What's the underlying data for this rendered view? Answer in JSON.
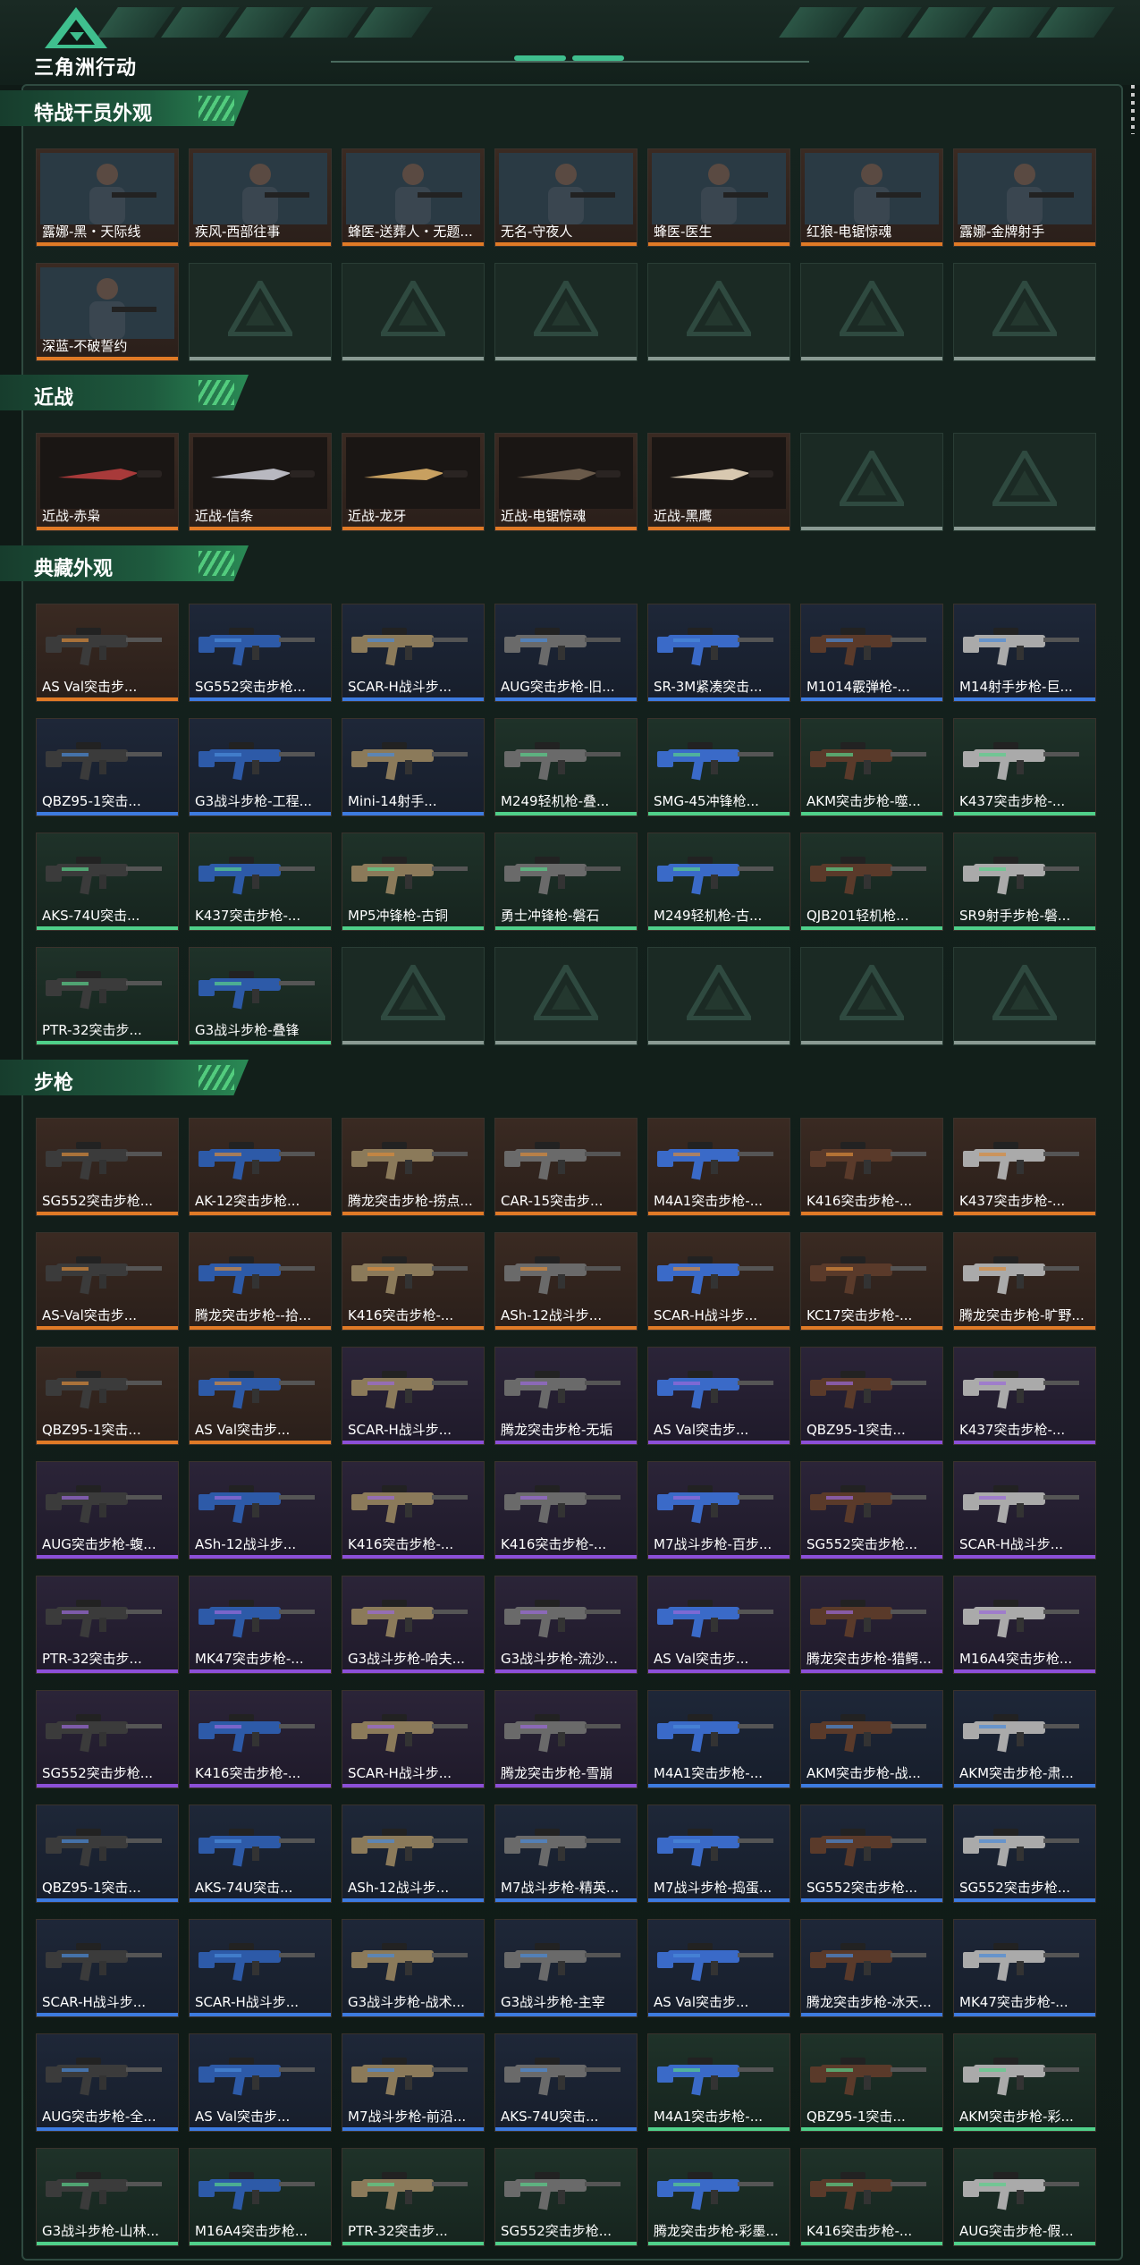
{
  "app": {
    "title": "三角洲行动",
    "logo_icon": "delta-triangle-logo-icon",
    "colors": {
      "accent": "#2a8a55",
      "orange": "#e07a26",
      "purple": "#8c4fd8",
      "blue": "#3d7be0",
      "green": "#4fd08a"
    }
  },
  "sections": [
    {
      "title": "特战干员外观",
      "items": [
        {
          "name": "露娜-黑・天际线",
          "tier": "orange"
        },
        {
          "name": "疾风-西部往事",
          "tier": "orange"
        },
        {
          "name": "蜂医-送葬人・无题...",
          "tier": "orange"
        },
        {
          "name": "无名-守夜人",
          "tier": "orange"
        },
        {
          "name": "蜂医-医生",
          "tier": "orange"
        },
        {
          "name": "红狼-电锯惊魂",
          "tier": "orange"
        },
        {
          "name": "露娜-金牌射手",
          "tier": "orange"
        },
        {
          "name": "深蓝-不破誓约",
          "tier": "orange"
        }
      ],
      "empty_slots": 6
    },
    {
      "title": "近战",
      "items": [
        {
          "name": "近战-赤枭",
          "tier": "orange"
        },
        {
          "name": "近战-信条",
          "tier": "orange"
        },
        {
          "name": "近战-龙牙",
          "tier": "orange"
        },
        {
          "name": "近战-电锯惊魂",
          "tier": "orange"
        },
        {
          "name": "近战-黑鹰",
          "tier": "orange"
        }
      ],
      "empty_slots": 2
    },
    {
      "title": "典藏外观",
      "items": [
        {
          "name": "AS Val突击步...",
          "tier": "orange"
        },
        {
          "name": "SG552突击步枪...",
          "tier": "blue"
        },
        {
          "name": "SCAR-H战斗步...",
          "tier": "blue"
        },
        {
          "name": "AUG突击步枪-旧...",
          "tier": "blue"
        },
        {
          "name": "SR-3M紧凑突击...",
          "tier": "blue"
        },
        {
          "name": "M1014霰弹枪-...",
          "tier": "blue"
        },
        {
          "name": "M14射手步枪-巨...",
          "tier": "blue"
        },
        {
          "name": "QBZ95-1突击...",
          "tier": "blue"
        },
        {
          "name": "G3战斗步枪-工程...",
          "tier": "blue"
        },
        {
          "name": "Mini-14射手...",
          "tier": "blue"
        },
        {
          "name": "M249轻机枪-叠...",
          "tier": "green"
        },
        {
          "name": "SMG-45冲锋枪...",
          "tier": "green"
        },
        {
          "name": "AKM突击步枪-噬...",
          "tier": "green"
        },
        {
          "name": "K437突击步枪-...",
          "tier": "green"
        },
        {
          "name": "AKS-74U突击...",
          "tier": "green"
        },
        {
          "name": "K437突击步枪-...",
          "tier": "green"
        },
        {
          "name": "MP5冲锋枪-古铜",
          "tier": "green"
        },
        {
          "name": "勇士冲锋枪-磐石",
          "tier": "green"
        },
        {
          "name": "M249轻机枪-古...",
          "tier": "green"
        },
        {
          "name": "QJB201轻机枪...",
          "tier": "green"
        },
        {
          "name": "SR9射手步枪-磐...",
          "tier": "green"
        },
        {
          "name": "PTR-32突击步...",
          "tier": "green"
        },
        {
          "name": "G3战斗步枪-叠锋",
          "tier": "green"
        }
      ],
      "empty_slots": 5
    },
    {
      "title": "步枪",
      "items": [
        {
          "name": "SG552突击步枪...",
          "tier": "orange"
        },
        {
          "name": "AK-12突击步枪...",
          "tier": "orange"
        },
        {
          "name": "腾龙突击步枪-捞点...",
          "tier": "orange"
        },
        {
          "name": "CAR-15突击步...",
          "tier": "orange"
        },
        {
          "name": "M4A1突击步枪-...",
          "tier": "orange"
        },
        {
          "name": "K416突击步枪-...",
          "tier": "orange"
        },
        {
          "name": "K437突击步枪-...",
          "tier": "orange"
        },
        {
          "name": "AS-Val突击步...",
          "tier": "orange"
        },
        {
          "name": "腾龙突击步枪--拾...",
          "tier": "orange"
        },
        {
          "name": "K416突击步枪-...",
          "tier": "orange"
        },
        {
          "name": "ASh-12战斗步...",
          "tier": "orange"
        },
        {
          "name": "SCAR-H战斗步...",
          "tier": "orange"
        },
        {
          "name": "KC17突击步枪-...",
          "tier": "orange"
        },
        {
          "name": "腾龙突击步枪-旷野...",
          "tier": "orange"
        },
        {
          "name": "QBZ95-1突击...",
          "tier": "orange"
        },
        {
          "name": "AS Val突击步...",
          "tier": "orange"
        },
        {
          "name": "SCAR-H战斗步...",
          "tier": "purple"
        },
        {
          "name": "腾龙突击步枪-无垢",
          "tier": "purple"
        },
        {
          "name": "AS Val突击步...",
          "tier": "purple"
        },
        {
          "name": "QBZ95-1突击...",
          "tier": "purple"
        },
        {
          "name": "K437突击步枪-...",
          "tier": "purple"
        },
        {
          "name": "AUG突击步枪-蝮...",
          "tier": "purple"
        },
        {
          "name": "ASh-12战斗步...",
          "tier": "purple"
        },
        {
          "name": "K416突击步枪-...",
          "tier": "purple"
        },
        {
          "name": "K416突击步枪-...",
          "tier": "purple"
        },
        {
          "name": "M7战斗步枪-百步...",
          "tier": "purple"
        },
        {
          "name": "SG552突击步枪...",
          "tier": "purple"
        },
        {
          "name": "SCAR-H战斗步...",
          "tier": "purple"
        },
        {
          "name": "PTR-32突击步...",
          "tier": "purple"
        },
        {
          "name": "MK47突击步枪-...",
          "tier": "purple"
        },
        {
          "name": "G3战斗步枪-哈夫...",
          "tier": "purple"
        },
        {
          "name": "G3战斗步枪-流沙...",
          "tier": "purple"
        },
        {
          "name": "AS Val突击步...",
          "tier": "purple"
        },
        {
          "name": "腾龙突击步枪-猎鳄...",
          "tier": "purple"
        },
        {
          "name": "M16A4突击步枪...",
          "tier": "purple"
        },
        {
          "name": "SG552突击步枪...",
          "tier": "purple"
        },
        {
          "name": "K416突击步枪-...",
          "tier": "purple"
        },
        {
          "name": "SCAR-H战斗步...",
          "tier": "purple"
        },
        {
          "name": "腾龙突击步枪-雪崩",
          "tier": "purple"
        },
        {
          "name": "M4A1突击步枪-...",
          "tier": "blue"
        },
        {
          "name": "AKM突击步枪-战...",
          "tier": "blue"
        },
        {
          "name": "AKM突击步枪-肃...",
          "tier": "blue"
        },
        {
          "name": "QBZ95-1突击...",
          "tier": "blue"
        },
        {
          "name": "AKS-74U突击...",
          "tier": "blue"
        },
        {
          "name": "ASh-12战斗步...",
          "tier": "blue"
        },
        {
          "name": "M7战斗步枪-精英...",
          "tier": "blue"
        },
        {
          "name": "M7战斗步枪-捣蛋...",
          "tier": "blue"
        },
        {
          "name": "SG552突击步枪...",
          "tier": "blue"
        },
        {
          "name": "SG552突击步枪...",
          "tier": "blue"
        },
        {
          "name": "SCAR-H战斗步...",
          "tier": "blue"
        },
        {
          "name": "SCAR-H战斗步...",
          "tier": "blue"
        },
        {
          "name": "G3战斗步枪-战术...",
          "tier": "blue"
        },
        {
          "name": "G3战斗步枪-主宰",
          "tier": "blue"
        },
        {
          "name": "AS Val突击步...",
          "tier": "blue"
        },
        {
          "name": "腾龙突击步枪-冰天...",
          "tier": "blue"
        },
        {
          "name": "MK47突击步枪-...",
          "tier": "blue"
        },
        {
          "name": "AUG突击步枪-全...",
          "tier": "blue"
        },
        {
          "name": "AS Val突击步...",
          "tier": "blue"
        },
        {
          "name": "M7战斗步枪-前沿...",
          "tier": "blue"
        },
        {
          "name": "AKS-74U突击...",
          "tier": "blue"
        },
        {
          "name": "M4A1突击步枪-...",
          "tier": "green"
        },
        {
          "name": "QBZ95-1突击...",
          "tier": "green"
        },
        {
          "name": "AKM突击步枪-彩...",
          "tier": "green"
        },
        {
          "name": "G3战斗步枪-山林...",
          "tier": "green"
        },
        {
          "name": "M16A4突击步枪...",
          "tier": "green"
        },
        {
          "name": "PTR-32突击步...",
          "tier": "green"
        },
        {
          "name": "SG552突击步枪...",
          "tier": "green"
        },
        {
          "name": "腾龙突击步枪-彩墨...",
          "tier": "green"
        },
        {
          "name": "K416突击步枪-...",
          "tier": "green"
        },
        {
          "name": "AUG突击步枪-假...",
          "tier": "green"
        }
      ],
      "empty_slots": 0
    }
  ]
}
